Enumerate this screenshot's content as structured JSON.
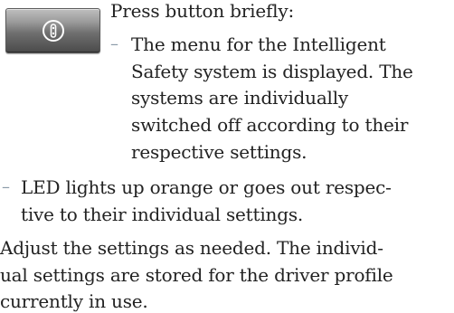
{
  "button": {
    "icon": "safety-system-icon"
  },
  "lines": {
    "l1": "Press button briefly:",
    "l2": "The menu for the Intelligent",
    "l3": "Safety system is displayed. The",
    "l4": "systems are individually",
    "l5": "switched off according to their",
    "l6": "respective settings.",
    "l7": "LED lights up orange or goes out respec-",
    "l8": "tive to their individual settings.",
    "l9": "Adjust the settings as needed. The individ-",
    "l10": "ual settings are stored for the driver profile",
    "l11": "currently in use."
  },
  "dash": "–",
  "colors": {
    "text": "#222222",
    "dash": "#8a9aa8",
    "button_top": "#bfbfbf",
    "button_bottom": "#4a4a4a",
    "icon": "#ffffff"
  }
}
